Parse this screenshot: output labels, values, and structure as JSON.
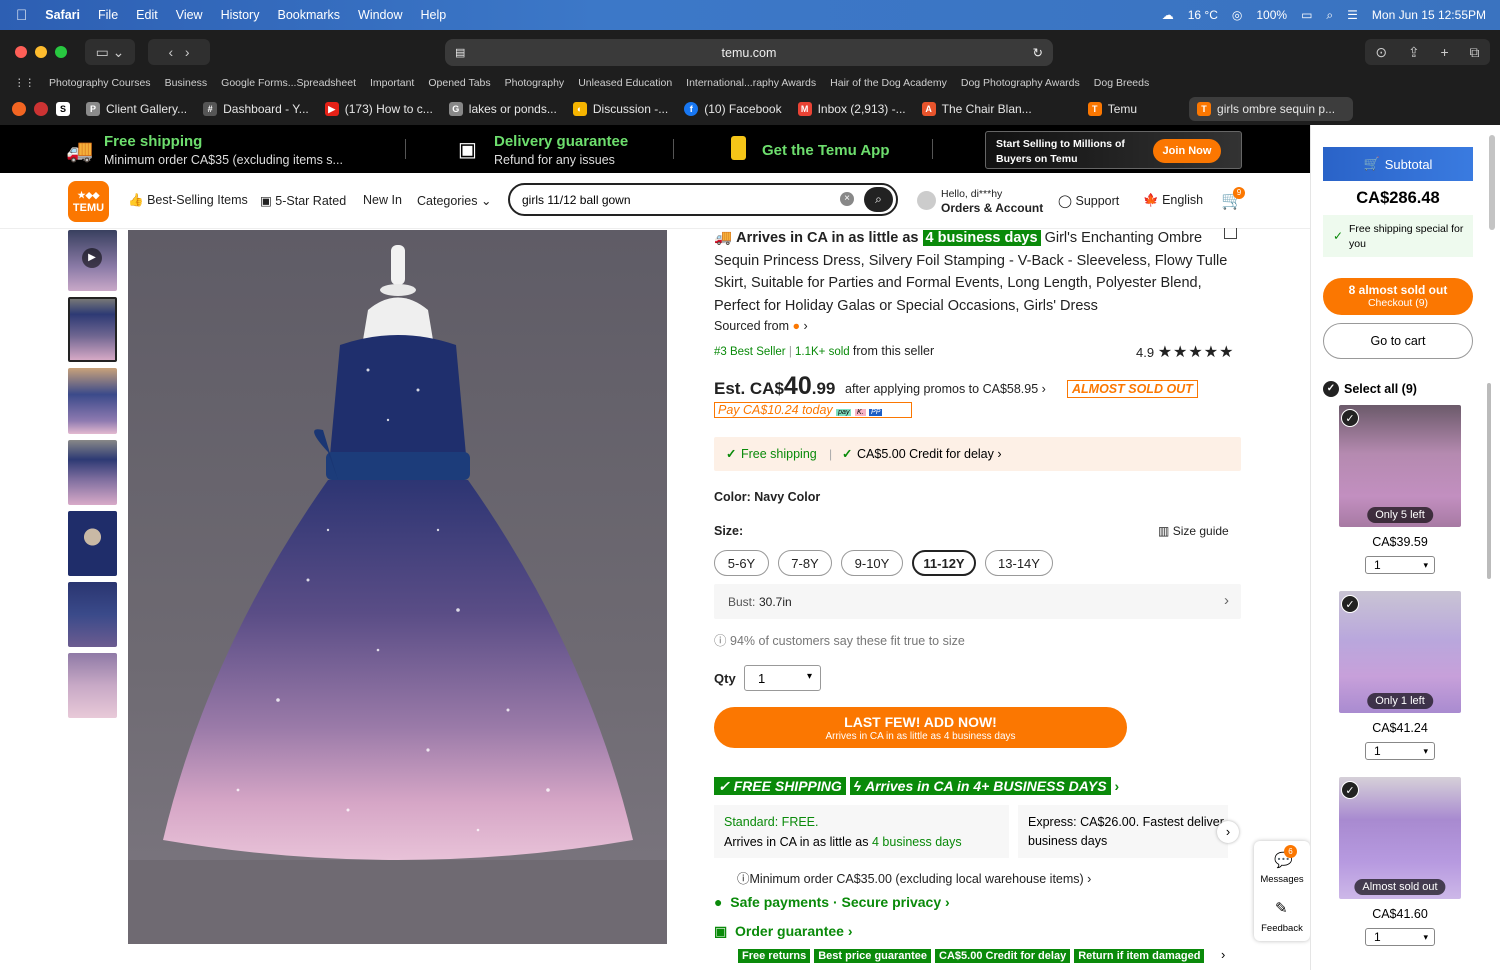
{
  "menubar": {
    "app": "Safari",
    "items": [
      "File",
      "Edit",
      "View",
      "History",
      "Bookmarks",
      "Window",
      "Help"
    ],
    "weather": "16 °C",
    "battery": "100%",
    "datetime": "Mon Jun 15  12:55PM"
  },
  "browser": {
    "url": "temu.com",
    "bookmarks": [
      "Photography Courses",
      "Business",
      "Google Forms...Spreadsheet",
      "Important",
      "Opened Tabs",
      "Photography",
      "Unleased Education",
      "International...raphy Awards",
      "Hair of the Dog Academy",
      "Dog Photography Awards",
      "Dog Breeds"
    ],
    "tabs": [
      {
        "label": "Client Gallery...",
        "icon": "P",
        "color": "#8a8a8a"
      },
      {
        "label": "Dashboard - Y...",
        "icon": "#",
        "color": "#555"
      },
      {
        "label": "(173) How to c...",
        "icon": "▶",
        "color": "#e62117"
      },
      {
        "label": "lakes or ponds...",
        "icon": "G",
        "color": "#888"
      },
      {
        "label": "Discussion -...",
        "icon": "◐",
        "color": "#f5b400"
      },
      {
        "label": "(10) Facebook",
        "icon": "f",
        "color": "#1877f2"
      },
      {
        "label": "Inbox (2,913) -...",
        "icon": "M",
        "color": "#ea4335"
      },
      {
        "label": "The Chair Blan...",
        "icon": "A",
        "color": "#e8542c"
      },
      {
        "label": "Temu",
        "icon": "T",
        "color": "#fb7701"
      },
      {
        "label": "girls ombre sequin p...",
        "icon": "T",
        "color": "#fb7701"
      }
    ]
  },
  "banner": {
    "free_shipping_title": "Free shipping",
    "free_shipping_sub": "Minimum order CA$35 (excluding items s...",
    "delivery_title": "Delivery guarantee",
    "delivery_sub": "Refund for any issues",
    "app_label": "Get the Temu App",
    "sell_text": "Start Selling to Millions of Buyers on Temu",
    "join_label": "Join Now"
  },
  "header": {
    "logo": "TEMU",
    "nav": [
      "Best-Selling Items",
      "5-Star Rated",
      "New In",
      "Categories"
    ],
    "search_value": "girls 11/12 ball gown",
    "greeting": "Hello, di***hy",
    "account": "Orders & Account",
    "support": "Support",
    "language": "English",
    "cart_count": "9"
  },
  "product": {
    "arrival_prefix": "Arrives in CA in as little as",
    "arrival_days": "4 business days",
    "title": "Girl's Enchanting Ombre Sequin Princess Dress, Silvery Foil Stamping - V-Back - Sleeveless, Flowy Tulle Skirt, Suitable for Parties and Formal Events, Long Length, Polyester Blend, Perfect for Holiday Galas or Special Occasions, Girls' Dress",
    "sourced_from": "Sourced from",
    "best_seller": "#3 Best Seller",
    "sold": "1.1K+ sold",
    "from_seller": "from this seller",
    "rating": "4.9",
    "price_prefix": "Est. CA$",
    "price_main": "40",
    "price_cents": ".99",
    "after_promos": "after applying promos to CA$58.95",
    "almost_sold_out": "ALMOST SOLD OUT",
    "pay_today": "Pay CA$10.24 today",
    "free_shipping": "Free shipping",
    "credit_delay": "CA$5.00 Credit for delay",
    "color_label": "Color: Navy Color",
    "size_label": "Size:",
    "size_guide": "Size guide",
    "sizes": [
      "5-6Y",
      "7-8Y",
      "9-10Y",
      "11-12Y",
      "13-14Y"
    ],
    "selected_size": "11-12Y",
    "bust_label": "Bust:",
    "bust_value": "30.7in",
    "fit_note": "94% of customers say these fit true to size",
    "qty_label": "Qty",
    "qty_value": "1",
    "cta_title": "LAST FEW! ADD NOW!",
    "cta_sub": "Arrives in CA in as little as 4 business days",
    "ship_tag1": "FREE SHIPPING",
    "ship_tag2": "Arrives in CA in 4+ BUSINESS DAYS",
    "standard_title": "Standard: FREE.",
    "standard_sub_prefix": "Arrives in CA in as little as",
    "standard_sub_days": "4 business days",
    "express_title": "Express: CA$26.00. Fastest deliver",
    "express_sub": "business days",
    "min_order": "Minimum order CA$35.00 (excluding local warehouse items)",
    "safe_payments": "Safe payments · Secure privacy",
    "order_guarantee": "Order guarantee",
    "guarantee_tags": [
      "Free returns",
      "Best price guarantee",
      "CA$5.00 Credit for delay",
      "Return if item damaged"
    ]
  },
  "floating": {
    "messages_label": "Messages",
    "messages_count": "6",
    "feedback_label": "Feedback"
  },
  "sidebar": {
    "subtotal_label": "Subtotal",
    "subtotal_value": "CA$286.48",
    "free_ship_note": "Free shipping special for you",
    "checkout_title": "8 almost sold out",
    "checkout_sub": "Checkout (9)",
    "go_to_cart": "Go to cart",
    "select_all": "Select all (9)",
    "items": [
      {
        "badge": "Only 5 left",
        "price": "CA$39.59",
        "qty": "1"
      },
      {
        "badge": "Only 1 left",
        "price": "CA$41.24",
        "qty": "1"
      },
      {
        "badge": "Almost sold out",
        "price": "CA$41.60",
        "qty": "1"
      }
    ]
  },
  "colors": {
    "accent": "#fb7701",
    "green": "#0a8a0a",
    "banner_bg": "#000000"
  }
}
